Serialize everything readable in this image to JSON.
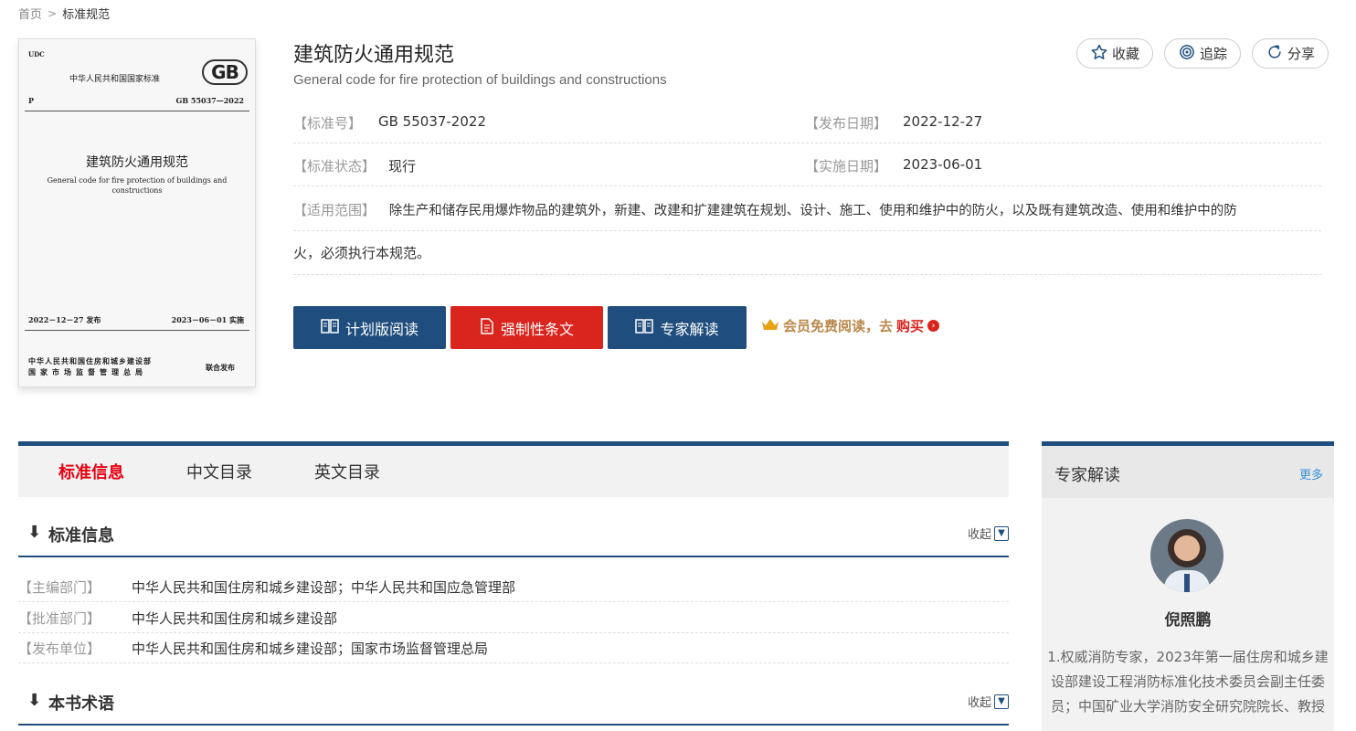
{
  "breadcrumb": {
    "home": "首页",
    "sep": ">",
    "current": "标准规范"
  },
  "cover": {
    "udc": "UDC",
    "national": "中华人民共和国国家标准",
    "logo": "GB",
    "p": "P",
    "code": "GB 55037—2022",
    "title_cn": "建筑防火通用规范",
    "title_en": "General code for fire protection of buildings and constructions",
    "issue": "2022－12－27  发布",
    "impl": "2023－06－01  实施",
    "pub1": "中华人民共和国住房和城乡建设部",
    "pub2": "国家市场监督管理总局",
    "joint": "联合发布"
  },
  "header": {
    "title": "建筑防火通用规范",
    "subtitle": "General code for fire protection of buildings and constructions"
  },
  "actions": {
    "fav": "收藏",
    "track": "追踪",
    "share": "分享"
  },
  "info": {
    "std_no_label": "【标准号】",
    "std_no": "GB 55037-2022",
    "pub_date_label": "【发布日期】",
    "pub_date": "2022-12-27",
    "status_label": "【标准状态】",
    "status": "现行",
    "impl_date_label": "【实施日期】",
    "impl_date": "2023-06-01",
    "scope_label": "【适用范围】",
    "scope_line1": "除生产和储存民用爆炸物品的建筑外，新建、改建和扩建建筑在规划、设计、施工、使用和维护中的防火，以及既有建筑改造、使用和维护中的防",
    "scope_line2": "火，必须执行本规范。"
  },
  "buttons": {
    "plan": "计划版阅读",
    "mandatory": "强制性条文",
    "expert": "专家解读"
  },
  "member": {
    "text": "会员免费阅读，去",
    "buy": "购买"
  },
  "tabs": [
    "标准信息",
    "中文目录",
    "英文目录"
  ],
  "section1": {
    "title": "标准信息",
    "collapse": "收起",
    "rows": [
      {
        "label": "【主编部门】",
        "value": "中华人民共和国住房和城乡建设部；中华人民共和国应急管理部"
      },
      {
        "label": "【批准部门】",
        "value": "中华人民共和国住房和城乡建设部"
      },
      {
        "label": "【发布单位】",
        "value": "中华人民共和国住房和城乡建设部；国家市场监督管理总局"
      }
    ]
  },
  "section2": {
    "title": "本书术语",
    "collapse": "收起"
  },
  "sidebar": {
    "title": "专家解读",
    "more": "更多",
    "expert_name": "倪照鹏",
    "expert_desc": "1.权威消防专家，2023年第一届住房和城乡建设部建设工程消防标准化技术委员会副主任委员；中国矿业大学消防安全研究院院长、教授"
  },
  "colors": {
    "brand": "#1f4e7e",
    "red": "#d9251d",
    "gold": "#b9884b"
  }
}
